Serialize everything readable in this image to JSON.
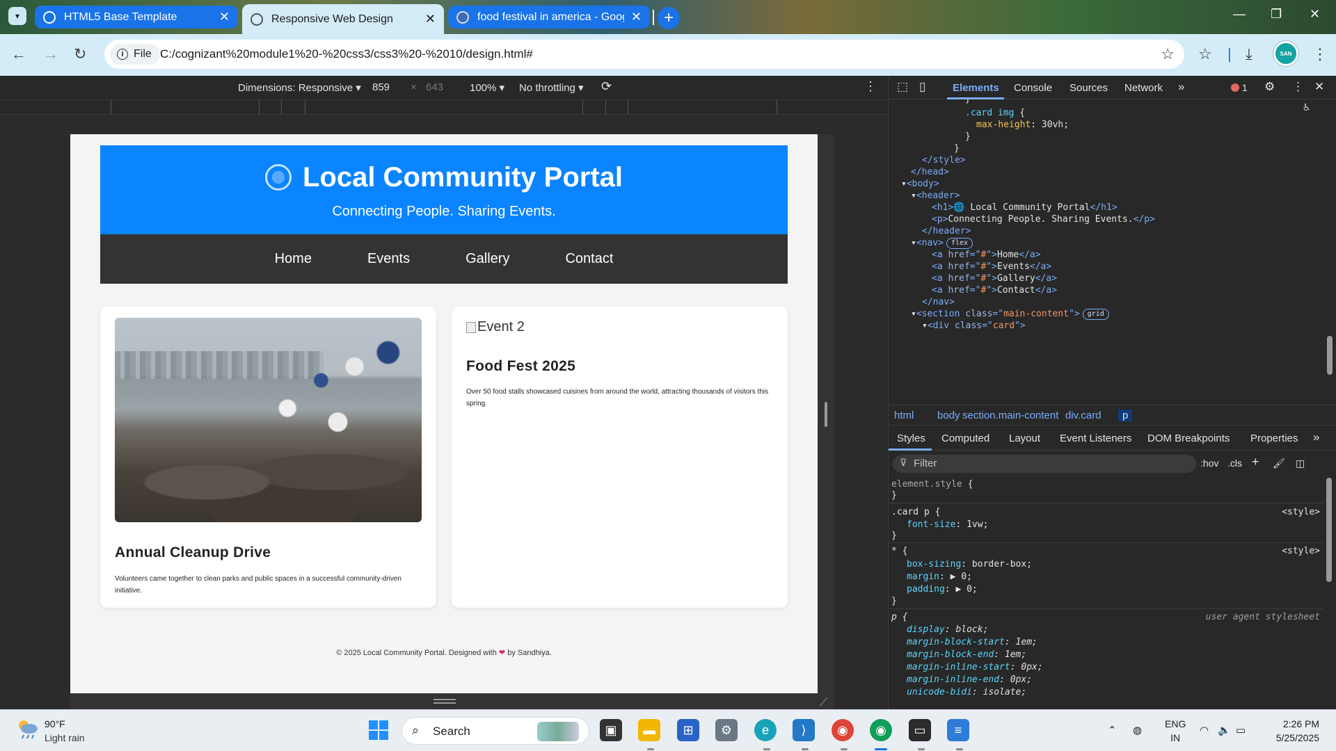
{
  "browser": {
    "tabs": [
      {
        "title": "HTML5 Base Template",
        "active": false
      },
      {
        "title": "Responsive Web Design",
        "active": true
      },
      {
        "title": "food festival in america - Googl",
        "active": false
      }
    ],
    "omnibox": {
      "chip": "File",
      "url": "C:/cognizant%20module1%20-%20css3/css3%20-%2010/design.html#"
    },
    "profile_initials": "SAN"
  },
  "device_toolbar": {
    "dimensions": "Dimensions: Responsive",
    "width": "859",
    "times": "×",
    "height": "643",
    "zoom": "100%",
    "throttling": "No throttling"
  },
  "site": {
    "header_title": "Local Community Portal",
    "header_subtitle": "Connecting People. Sharing Events.",
    "nav": [
      "Home",
      "Events",
      "Gallery",
      "Contact"
    ],
    "cards": [
      {
        "title": "Annual Cleanup Drive",
        "text": "Volunteers came together to clean parks and public spaces in a successful community-driven initiative."
      },
      {
        "img_alt": "Event 2",
        "title": "Food Fest 2025",
        "text": "Over 50 food stalls showcased cuisines from around the world, attracting thousands of visitors this spring."
      }
    ],
    "footer_prefix": "© 2025 Local Community Portal. Designed with",
    "footer_suffix": "by Sandhiya."
  },
  "devtools": {
    "tabs": [
      "Elements",
      "Console",
      "Sources",
      "Network"
    ],
    "error_count": "1",
    "breadcrumb": [
      "html",
      "body",
      "section.main-content",
      "div.card",
      "p"
    ],
    "styles_tabs": [
      "Styles",
      "Computed",
      "Layout",
      "Event Listeners",
      "DOM Breakpoints",
      "Properties"
    ],
    "filter_placeholder": "Filter",
    "hov": ":hov",
    "cls": ".cls",
    "dom_text": {
      "h1": "🌐 Local Community Portal",
      "p": "Connecting People. Sharing Events.",
      "links": [
        "Home",
        "Events",
        "Gallery",
        "Contact"
      ],
      "section_class": "main-content",
      "div_class": "card"
    },
    "style_source": "<style>",
    "ua_source": "user agent stylesheet"
  },
  "taskbar": {
    "weather_temp": "90°F",
    "weather_desc": "Light rain",
    "search_label": "Search",
    "lang_top": "ENG",
    "lang_bottom": "IN",
    "time": "2:26 PM",
    "date": "5/25/2025"
  }
}
